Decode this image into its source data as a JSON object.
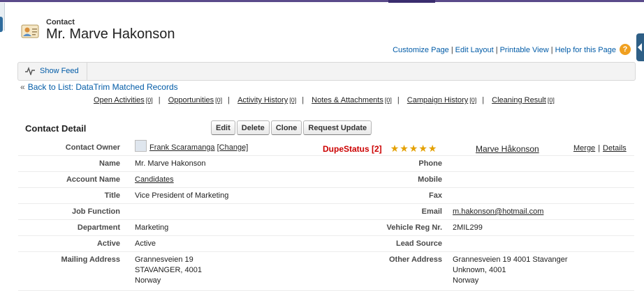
{
  "header": {
    "record_type": "Contact",
    "record_name": "Mr. Marve Hakonson",
    "links": [
      "Customize Page",
      "Edit Layout",
      "Printable View",
      "Help for this Page"
    ],
    "help_icon": "?"
  },
  "feed": {
    "label": "Show Feed"
  },
  "back_link": {
    "prefix": "«",
    "label": "Back to List: DataTrim Matched Records"
  },
  "related_lists": [
    {
      "label": "Open Activities",
      "count": "[0]"
    },
    {
      "label": "Opportunities",
      "count": "[0]"
    },
    {
      "label": "Activity History",
      "count": "[0]"
    },
    {
      "label": "Notes & Attachments",
      "count": "[0]"
    },
    {
      "label": "Campaign History",
      "count": "[0]"
    },
    {
      "label": "Cleaning Result",
      "count": "[0]"
    }
  ],
  "detail": {
    "title": "Contact Detail",
    "buttons": [
      "Edit",
      "Delete",
      "Clone",
      "Request Update"
    ],
    "owner": {
      "label": "Contact Owner",
      "name": "Frank Scaramanga",
      "change": "[Change]"
    },
    "dupe": {
      "status": "DupeStatus [2]",
      "stars": "★★★★★",
      "rating": 5,
      "match_name": "Marve Håkonson",
      "merge": "Merge",
      "details": "Details"
    },
    "rows": [
      {
        "l1": "Name",
        "v1": "Mr. Marve Hakonson",
        "l2": "Phone",
        "v2": ""
      },
      {
        "l1": "Account Name",
        "v1": "Candidates",
        "l2": "Mobile",
        "v2": ""
      },
      {
        "l1": "Title",
        "v1": "Vice President of Marketing",
        "l2": "Fax",
        "v2": ""
      },
      {
        "l1": "Job Function",
        "v1": "",
        "l2": "Email",
        "v2": "m.hakonson@hotmail.com"
      },
      {
        "l1": "Department",
        "v1": "Marketing",
        "l2": "Vehicle Reg Nr.",
        "v2": "2MIL299"
      },
      {
        "l1": "Active",
        "v1": "Active",
        "l2": "Lead Source",
        "v2": ""
      }
    ],
    "address": {
      "l1": "Mailing Address",
      "v1": [
        "Grannesveien 19",
        "STAVANGER, 4001",
        "Norway"
      ],
      "l2": "Other Address",
      "v2": [
        "Grannesveien 19 4001 Stavanger",
        "Unknown, 4001",
        "Norway"
      ]
    }
  },
  "colors": {
    "link": "#015ba7",
    "dupe": "#cc0000",
    "star": "#e4a000",
    "topbar": "#5a4a8a"
  }
}
